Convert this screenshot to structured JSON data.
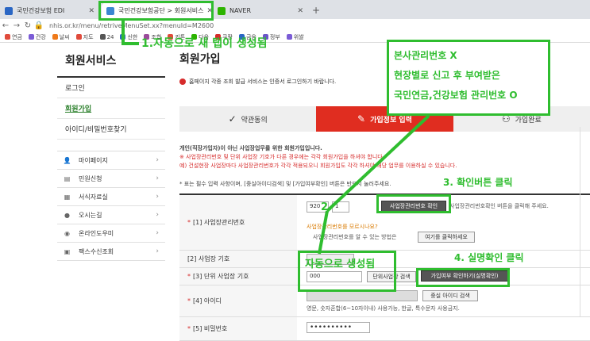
{
  "browser": {
    "tabs": [
      {
        "title": "국민건강보험 EDI",
        "color": "#2a66c4"
      },
      {
        "title": "국민건강보험공단 > 회원서비스",
        "color": "#3b86d1"
      },
      {
        "title": "NAVER",
        "color": "#2db400"
      }
    ],
    "url": "nhis.or.kr/menu/retriveMenuSet.xx?menuId=M2600",
    "bookmarks": [
      "연금",
      "건강",
      "날씨",
      "지도",
      "24",
      "신한",
      "조합",
      "키톤",
      "다음",
      "쿠팡",
      "금융",
      "정부",
      "위쌀"
    ]
  },
  "sidebar": {
    "title": "회원서비스",
    "links": [
      "로그인",
      "회원가입",
      "아이디/비밀번호찾기"
    ],
    "menu": [
      {
        "label": "마이페이지",
        "icon": "person-icon"
      },
      {
        "label": "민원신청",
        "icon": "document-icon"
      },
      {
        "label": "서식자료실",
        "icon": "folder-icon"
      },
      {
        "label": "오시는길",
        "icon": "location-icon"
      },
      {
        "label": "온라인도우미",
        "icon": "headset-icon"
      },
      {
        "label": "팩스수신조회",
        "icon": "fax-icon"
      }
    ]
  },
  "main": {
    "title": "회원가입",
    "notice": "홈페이지 각종 조회 발급 서비스는 인증서 로그인하기 바랍니다.",
    "steps": [
      "약관동의",
      "가입정보 입력",
      "가입완료"
    ],
    "desc_line1": "개인(직장가입자)이 아닌 사업장업무를 위한 회원가입입니다.",
    "desc_line2": "※ 사업장관리번호 및 단위 사업장 기호가 다른 경우에는 각각 회원가입을 하셔야 합니다",
    "desc_line3": "예) 건설현장 사업장마다 사업장관리번호가 각각 적용되오니 회원가입도 각각 하셔야 해당 업무를 이용하실 수 있습니다.",
    "required_note": "* 표는 필수 입력 사항이며, [중실아이디검색] 및 [가입여부확인] 버튼은 반드시 눌러주세요.",
    "form": {
      "biz_no_label": "[1] 사업장관리번호",
      "biz_no_value": "920",
      "biz_no_suffix": "1",
      "biz_confirm_btn": "사업장관리번호 확인",
      "biz_confirm_hint": "사업장관리번호확인 버튼을 클릭해 주세요.",
      "biz_unknown_q": "사업장관리번호를 모르시나요?",
      "biz_unknown_help": "사업장관리번호를 알 수 있는 방법은",
      "biz_unknown_btn": "여기를 클릭하세요",
      "biz_sign_label": "[2] 사업장 기호",
      "unit_sign_label": "[3] 단위 사업장 기호",
      "unit_sign_value": "000",
      "unit_search_btn": "단위사업장 검색",
      "join_check_btn": "가입여부 확인하기(실명확인)",
      "id_label": "[4] 아이디",
      "id_check_btn": "중실 아이디 검색",
      "id_hint": "영문, 숫자혼합(6~10자이내) 사용가능, 한글, 특수문자 사용금지.",
      "pw_label": "[5] 비밀번호",
      "pw_value": "••••••••••"
    }
  },
  "annotations": {
    "note1": "1.자동으로 새 탭이 생성됨",
    "callout_line1": "본사관리번호 X",
    "callout_line2": "현장별로 신고 후 부여받은",
    "callout_line3": "국민연금,건강보험 관리번호 O",
    "note2": "2.",
    "note3": "3. 확인버튼 클릭",
    "auto_created": "자동으로 생성됨",
    "note4": "4. 실명확인 클릭",
    "color": "#2fbd2f"
  }
}
